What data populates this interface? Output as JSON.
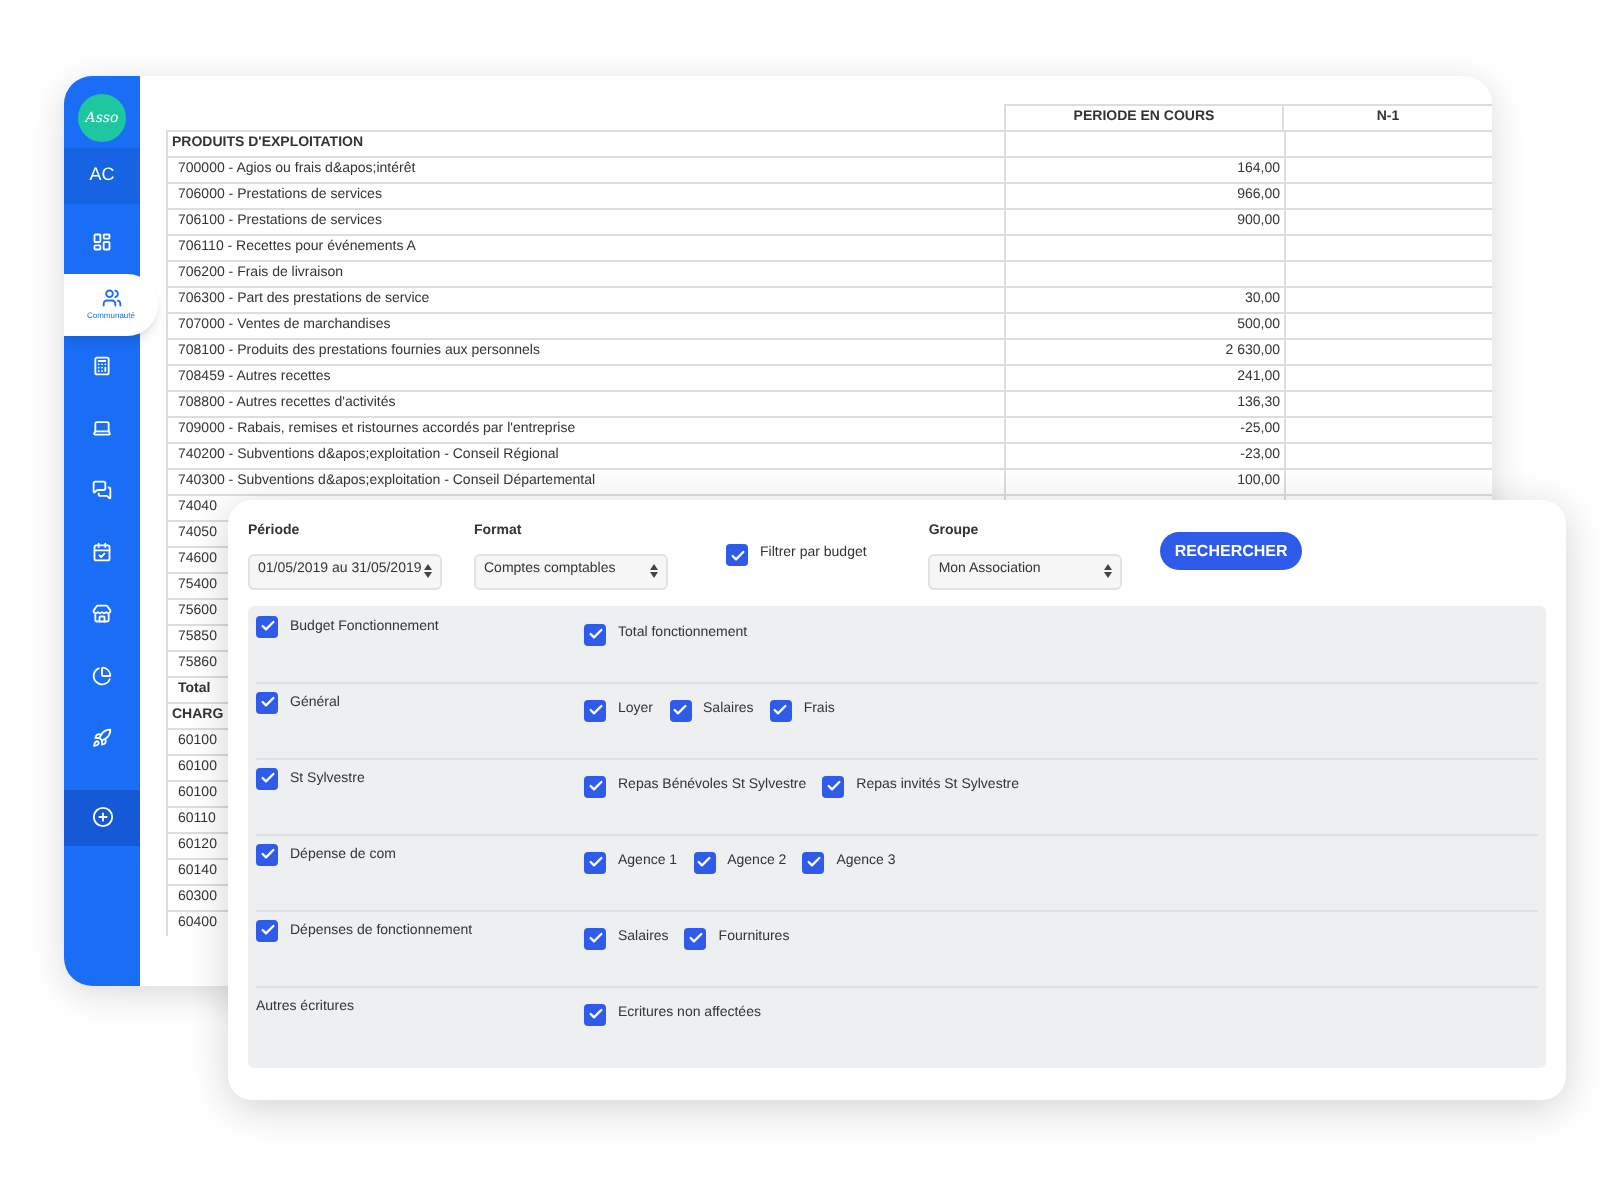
{
  "sidebar": {
    "logo": "Asso",
    "initials": "AC",
    "items": [
      {
        "selected": false
      },
      {
        "selected": true,
        "label": "Communauté"
      },
      {
        "selected": false
      },
      {
        "selected": false
      },
      {
        "selected": false
      },
      {
        "selected": false
      },
      {
        "selected": false
      },
      {
        "selected": false
      },
      {
        "selected": false
      }
    ],
    "add": {
      "selected": false
    }
  },
  "table": {
    "columns": [
      "PERIODE EN COURS",
      "N-1"
    ],
    "rows": [
      {
        "kind": "section",
        "label": "PRODUITS D'EXPLOITATION"
      },
      {
        "kind": "account",
        "label": "700000 - Agios ou frais d&apos;intérêt",
        "value": "164,00"
      },
      {
        "kind": "account",
        "label": "706000 - Prestations de services",
        "value": "966,00"
      },
      {
        "kind": "account",
        "label": "706100 - Prestations de services",
        "value": "900,00"
      },
      {
        "kind": "account",
        "label": "706110 - Recettes pour événements A"
      },
      {
        "kind": "account",
        "label": "706200 - Frais de livraison"
      },
      {
        "kind": "account",
        "label": "706300 - Part des prestations de service",
        "value": "30,00"
      },
      {
        "kind": "account",
        "label": "707000 - Ventes de marchandises",
        "value": "500,00"
      },
      {
        "kind": "account",
        "label": "708100 - Produits des prestations fournies aux personnels",
        "value": "2 630,00"
      },
      {
        "kind": "account",
        "label": "708459 - Autres recettes",
        "value": "241,00"
      },
      {
        "kind": "account",
        "label": "708800 - Autres recettes d'activités",
        "value": "136,30"
      },
      {
        "kind": "account",
        "label": "709000 - Rabais, remises et ristournes accordés par l'entreprise",
        "value": "-25,00"
      },
      {
        "kind": "account",
        "label": "740200 - Subventions d&apos;exploitation - Conseil Régional",
        "value": "-23,00"
      },
      {
        "kind": "account",
        "label": "740300 - Subventions d&apos;exploitation - Conseil Départemental",
        "value": "100,00"
      },
      {
        "kind": "account",
        "label": "74040"
      },
      {
        "kind": "account",
        "label": "74050"
      },
      {
        "kind": "account",
        "label": "74600"
      },
      {
        "kind": "account",
        "label": "75400"
      },
      {
        "kind": "account",
        "label": "75600"
      },
      {
        "kind": "account",
        "label": "75850"
      },
      {
        "kind": "account",
        "label": "75860"
      },
      {
        "kind": "total",
        "label": "Total"
      },
      {
        "kind": "section",
        "label": "CHARG"
      },
      {
        "kind": "account",
        "label": "60100"
      },
      {
        "kind": "account",
        "label": "60100"
      },
      {
        "kind": "account",
        "label": "60100"
      },
      {
        "kind": "account",
        "label": "60110"
      },
      {
        "kind": "account",
        "label": "60120"
      },
      {
        "kind": "account",
        "label": "60140"
      },
      {
        "kind": "account",
        "label": "60300"
      },
      {
        "kind": "account",
        "label": "60400"
      }
    ]
  },
  "filters": {
    "period": {
      "label": "Période",
      "value": "01/05/2019 au 31/05/2019"
    },
    "format": {
      "label": "Format",
      "value": "Comptes comptables"
    },
    "budget_filter": {
      "label": "Filtrer par budget",
      "checked": true
    },
    "group": {
      "label": "Groupe",
      "value": "Mon Association"
    },
    "search_button": "RECHERCHER"
  },
  "budgets": [
    {
      "label": "Budget Fonctionnement",
      "checked": true,
      "options": [
        {
          "label": "Total fonctionnement",
          "checked": true
        }
      ]
    },
    {
      "label": "Général",
      "checked": true,
      "options": [
        {
          "label": "Loyer",
          "checked": true
        },
        {
          "label": "Salaires",
          "checked": true
        },
        {
          "label": "Frais",
          "checked": true
        }
      ]
    },
    {
      "label": "St Sylvestre",
      "checked": true,
      "options": [
        {
          "label": "Repas Bénévoles St Sylvestre",
          "checked": true
        },
        {
          "label": "Repas invités St Sylvestre",
          "checked": true
        }
      ]
    },
    {
      "label": "Dépense de com",
      "checked": true,
      "options": [
        {
          "label": "Agence 1",
          "checked": true
        },
        {
          "label": "Agence 2",
          "checked": true
        },
        {
          "label": "Agence 3",
          "checked": true
        }
      ]
    },
    {
      "label": "Dépenses de fonctionnement",
      "checked": true,
      "options": [
        {
          "label": "Salaires",
          "checked": true
        },
        {
          "label": "Fournitures",
          "checked": true
        }
      ]
    },
    {
      "label": "Autres écritures",
      "options": [
        {
          "label": "Ecritures non affectées",
          "checked": true
        }
      ]
    }
  ]
}
